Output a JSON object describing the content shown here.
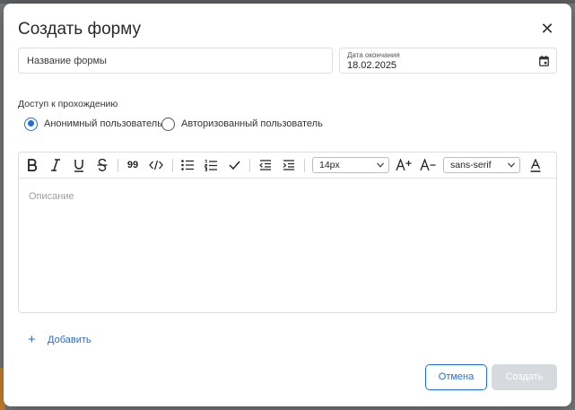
{
  "dialog": {
    "title": "Создать форму",
    "close_glyph": "✕"
  },
  "form": {
    "name_placeholder": "Название формы",
    "end_date_label": "Дата окончания",
    "end_date_value": "18.02.2025",
    "access_label": "Доступ к прохождению",
    "access_options": [
      {
        "label": "Анонимный пользователь",
        "selected": true
      },
      {
        "label": "Авторизованный пользователь",
        "selected": false
      }
    ]
  },
  "editor": {
    "toolbar": {
      "quote_label": "99",
      "font_size": "14px",
      "font_family": "sans-serif",
      "icons": [
        "bold-icon",
        "italic-icon",
        "underline-icon",
        "strikethrough-icon",
        "quote-icon",
        "code-icon",
        "bullet-list-icon",
        "numbered-list-icon",
        "check-icon",
        "outdent-icon",
        "indent-icon",
        "increase-font-icon",
        "decrease-font-icon",
        "text-color-icon"
      ]
    },
    "placeholder": "Описание"
  },
  "actions": {
    "add_label": "Добавить",
    "cancel_label": "Отмена",
    "create_label": "Создать"
  },
  "colors": {
    "accent": "#1e6fd9",
    "disabled_button": "#d6d9de"
  }
}
